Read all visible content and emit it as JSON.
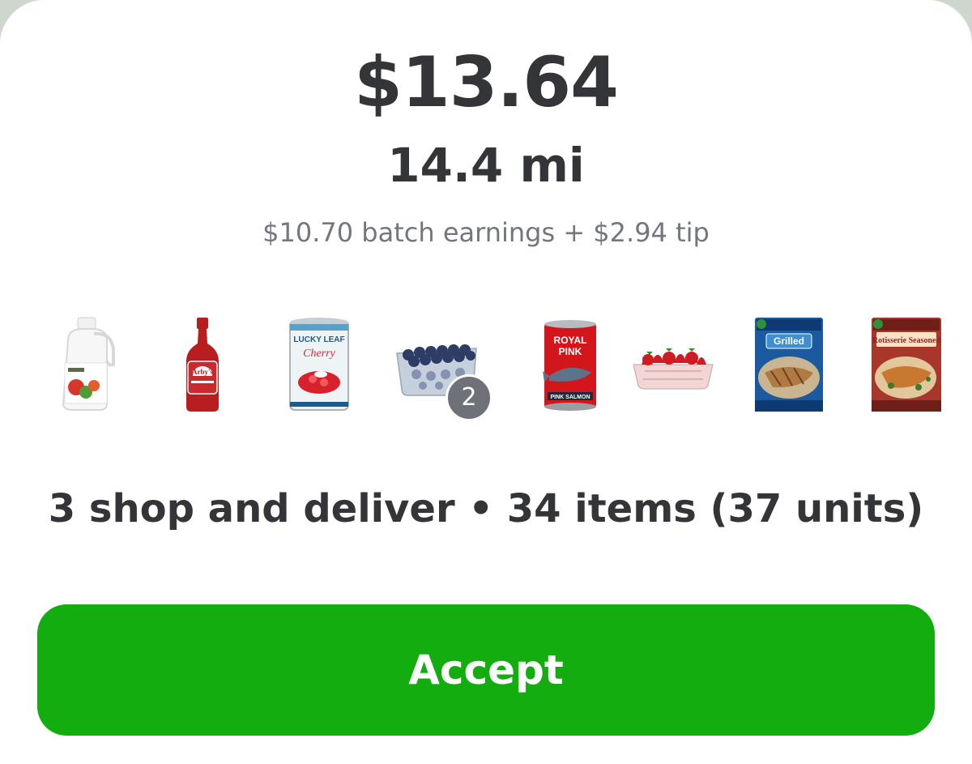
{
  "offer": {
    "total": "$13.64",
    "distance": "14.4 mi",
    "breakdown": "$10.70 batch earnings + $2.94 tip"
  },
  "items": [
    {
      "name": "white-vinegar-jug-image",
      "icon": "vinegar-jug"
    },
    {
      "name": "arbys-sauce-bottle-image",
      "icon": "sauce-bottle",
      "label": "Arby's"
    },
    {
      "name": "lucky-leaf-cherry-can-image",
      "icon": "pie-filling-can",
      "label": "LUCKY LEAF",
      "sublabel": "Cherry"
    },
    {
      "name": "blueberries-container-image",
      "icon": "blueberries",
      "quantity": "2"
    },
    {
      "name": "royal-pink-salmon-can-image",
      "icon": "salmon-can",
      "label": "ROYAL PINK",
      "sublabel": "PINK SALMON"
    },
    {
      "name": "strawberries-container-image",
      "icon": "strawberries"
    },
    {
      "name": "grilled-chicken-bag-image",
      "icon": "frozen-bag",
      "label": "Grilled"
    },
    {
      "name": "rotisserie-seasoned-chicken-bag-image",
      "icon": "frozen-bag",
      "label": "Rotisserie Seasoned"
    }
  ],
  "summary": "3 shop and deliver • 34 items (37 units)",
  "actions": {
    "accept_label": "Accept"
  },
  "colors": {
    "accent": "#14ad0f",
    "text": "#343538",
    "muted": "#72767e"
  }
}
